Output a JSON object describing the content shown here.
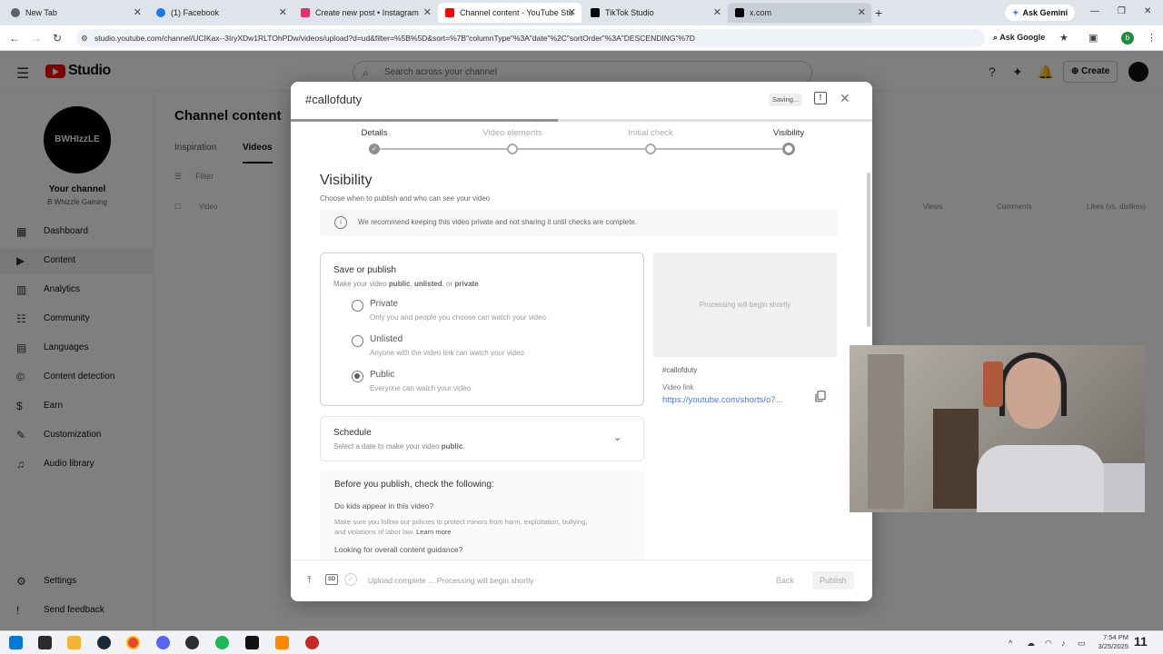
{
  "browser": {
    "tabs": [
      {
        "label": "New Tab",
        "favicon": "chrome-newtab-icon",
        "color": "#5f6368"
      },
      {
        "label": "(1) Facebook",
        "favicon": "facebook-icon",
        "color": "#1877f2"
      },
      {
        "label": "Create new post • Instagram",
        "favicon": "instagram-icon",
        "color": "#e1306c"
      },
      {
        "label": "Channel content - YouTube Stu",
        "favicon": "youtube-icon",
        "color": "#ff0000"
      },
      {
        "label": "TikTok Studio",
        "favicon": "tiktok-icon",
        "color": "#000000"
      },
      {
        "label": "x.com",
        "favicon": "x-icon",
        "color": "#000000"
      }
    ],
    "new_tab": "+",
    "gemini_label": "Ask Gemini",
    "url": "studio.youtube.com/channel/UCIKax--3IryXDw1RLTOhPDw/videos/upload?d=ud&filter=%5B%5D&sort=%7B\"columnType\"%3A\"date\"%2C\"sortOrder\"%3A\"DESCENDING\"%7D",
    "ask_google": "Ask Google",
    "profile_initial": "b"
  },
  "studio": {
    "logo_text": "Studio",
    "search_placeholder": "Search across your channel",
    "create_label": "Create",
    "channel_avatar_text": "BWHIzzLE",
    "channel_title": "Your channel",
    "channel_name": "B Whizzle Gaming",
    "sidebar": [
      {
        "label": "Dashboard",
        "icon": "dashboard-icon"
      },
      {
        "label": "Content",
        "icon": "content-icon",
        "active": true
      },
      {
        "label": "Analytics",
        "icon": "analytics-icon"
      },
      {
        "label": "Community",
        "icon": "community-icon"
      },
      {
        "label": "Languages",
        "icon": "languages-icon"
      },
      {
        "label": "Content detection",
        "icon": "content-detection-icon"
      },
      {
        "label": "Earn",
        "icon": "earn-icon"
      },
      {
        "label": "Customization",
        "icon": "customization-icon"
      },
      {
        "label": "Audio library",
        "icon": "audio-library-icon"
      }
    ],
    "sidebar_bottom": [
      {
        "label": "Settings",
        "icon": "gear-icon"
      },
      {
        "label": "Send feedback",
        "icon": "feedback-icon"
      }
    ],
    "page_title": "Channel content",
    "tabs": [
      "Inspiration",
      "Videos"
    ],
    "filter_label": "Filter",
    "columns": [
      "Video",
      "Views",
      "Comments",
      "Likes (vs. dislikes)"
    ]
  },
  "modal": {
    "title": "#callofduty",
    "saving_label": "Saving...",
    "progress": 0.46,
    "steps": [
      {
        "label": "Details",
        "state": "done"
      },
      {
        "label": "Video elements",
        "state": "todo"
      },
      {
        "label": "Initial check",
        "state": "todo"
      },
      {
        "label": "Visibility",
        "state": "current"
      }
    ],
    "visibility": {
      "title": "Visibility",
      "subtitle": "Choose when to publish and who can see your video",
      "info": "We recommend keeping this video private and not sharing it until checks are complete.",
      "save_title": "Save or publish",
      "save_sub_prefix": "Make your video ",
      "save_sub_public": "public",
      "save_sub_sep": ", ",
      "save_sub_unlisted": "unlisted",
      "save_sub_or": ", or ",
      "save_sub_private": "private",
      "options": [
        {
          "label": "Private",
          "desc": "Only you and people you choose can watch your video",
          "checked": false
        },
        {
          "label": "Unlisted",
          "desc": "Anyone with the video link can watch your video",
          "checked": false
        },
        {
          "label": "Public",
          "desc": "Everyone can watch your video",
          "checked": true
        }
      ],
      "schedule_title": "Schedule",
      "schedule_sub_prefix": "Select a date to make your video ",
      "schedule_sub_bold": "public",
      "schedule_sub_suffix": ".",
      "check_title": "Before you publish, check the following:",
      "check_q1": "Do kids appear in this video?",
      "check_desc": "Make sure you follow our policies to protect minors from harm, exploitation, bullying, and violations of labor law.",
      "check_learn_more": "Learn more",
      "check_q2": "Looking for overall content guidance?"
    },
    "preview": {
      "placeholder": "Processing will begin shortly",
      "video_title": "#callofduty",
      "link_label": "Video link",
      "link": "https://youtube.com/shorts/o7..."
    },
    "footer": {
      "sd_label": "SD",
      "status": "Upload complete ... Processing will begin shortly",
      "back_label": "Back",
      "publish_label": "Publish"
    }
  },
  "taskbar": {
    "apps": [
      {
        "icon": "windows-start-icon",
        "color": "#0078d4"
      },
      {
        "icon": "app-icon",
        "color": "#2b2b2b"
      },
      {
        "icon": "file-explorer-icon",
        "color": "#f2b632"
      },
      {
        "icon": "steam-icon",
        "color": "#1b2838"
      },
      {
        "icon": "chrome-icon",
        "color": "#ea4335"
      },
      {
        "icon": "discord-icon",
        "color": "#5865f2"
      },
      {
        "icon": "obs-icon",
        "color": "#302e31"
      },
      {
        "icon": "spotify-icon",
        "color": "#1db954"
      },
      {
        "icon": "capcut-icon",
        "color": "#111111"
      },
      {
        "icon": "vlc-icon",
        "color": "#ff8800"
      },
      {
        "icon": "app-red-icon",
        "color": "#c62828"
      }
    ],
    "time": "7:54 PM",
    "date": "3/25/2025",
    "logo_text": "11"
  }
}
